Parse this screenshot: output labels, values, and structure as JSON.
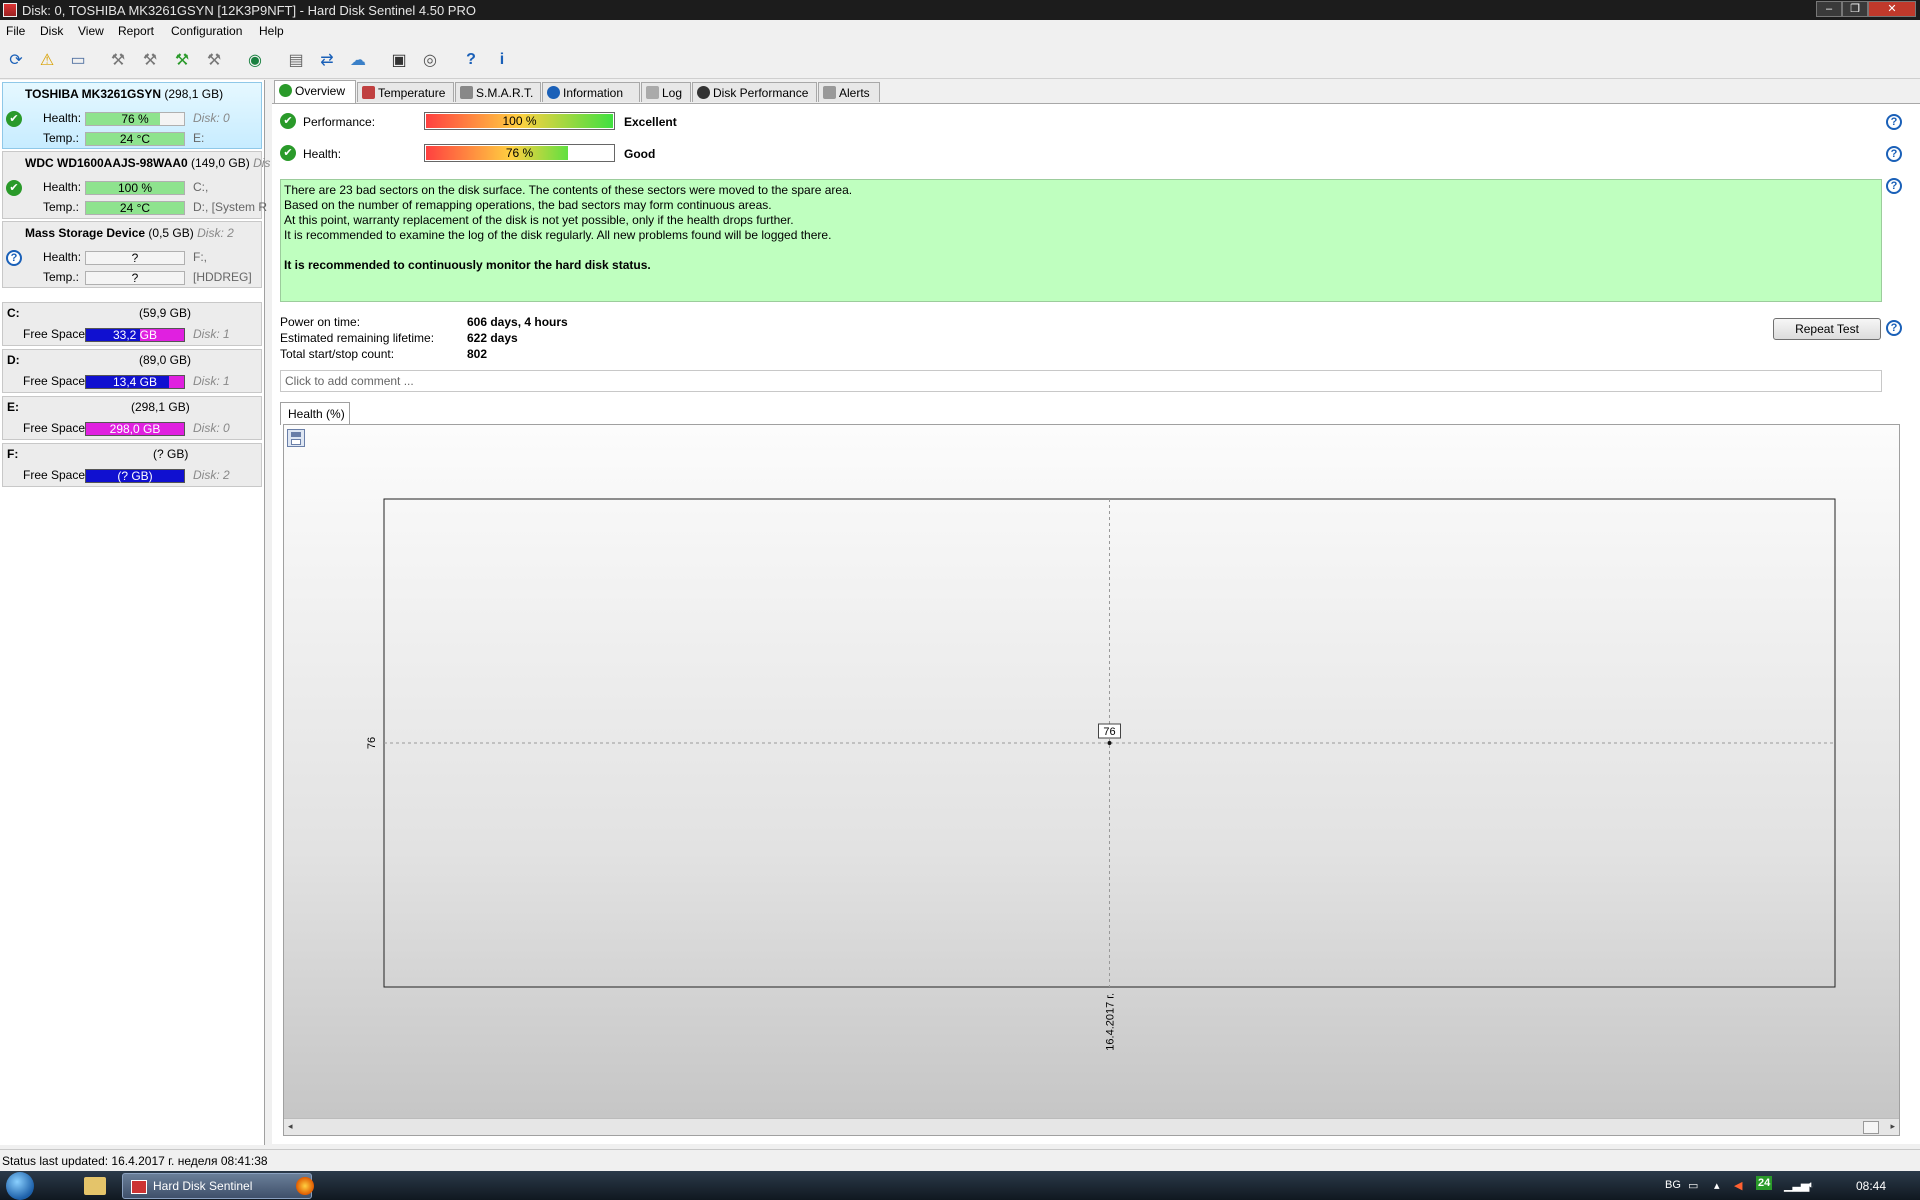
{
  "window": {
    "title": "Disk: 0, TOSHIBA MK3261GSYN [12K3P9NFT]  -  Hard Disk Sentinel 4.50 PRO"
  },
  "menu": [
    "File",
    "Disk",
    "View",
    "Report",
    "Configuration",
    "Help"
  ],
  "disks": [
    {
      "name": "TOSHIBA MK3261GSYN",
      "size": "(298,1 GB)",
      "health_label": "Health:",
      "health": "76 %",
      "health_fraction": 0.76,
      "disk_id": "Disk: 0",
      "temp_label": "Temp.:",
      "temp": "24 °C",
      "drives": "E:",
      "status": "ok"
    },
    {
      "name": "WDC WD1600AAJS-98WAA0",
      "size": "(149,0 GB)",
      "size_suffix": "Dis",
      "health_label": "Health:",
      "health": "100 %",
      "health_fraction": 1.0,
      "disk_id": "C:,",
      "temp_label": "Temp.:",
      "temp": "24 °C",
      "drives": "D:,  [System R",
      "status": "ok"
    },
    {
      "name": "Mass   Storage Device",
      "size": "(0,5 GB)",
      "size_suffix": "Disk: 2",
      "health_label": "Health:",
      "health": "?",
      "health_fraction": 0,
      "disk_id": "F:,",
      "temp_label": "Temp.:",
      "temp": "?",
      "drives": "[HDDREG]",
      "status": "unknown"
    }
  ],
  "volumes": [
    {
      "letter": "C:",
      "size": "(59,9 GB)",
      "free_label": "Free Space",
      "free": "33,2 GB",
      "free_fraction": 0.55,
      "disk": "Disk: 1"
    },
    {
      "letter": "D:",
      "size": "(89,0 GB)",
      "free_label": "Free Space",
      "free": "13,4 GB",
      "free_fraction": 0.85,
      "disk": "Disk: 1"
    },
    {
      "letter": "E:",
      "size": "(298,1 GB)",
      "free_label": "Free Space",
      "free": "298,0 GB",
      "free_fraction": 0.0,
      "disk": "Disk: 0"
    },
    {
      "letter": "F:",
      "size": "(? GB)",
      "free_label": "Free Space",
      "free": "(? GB)",
      "free_fraction": 1.0,
      "disk": "Disk: 2"
    }
  ],
  "tabs": [
    "Overview",
    "Temperature",
    "S.M.A.R.T.",
    "Information",
    "Log",
    "Disk Performance",
    "Alerts"
  ],
  "overview": {
    "performance_label": "Performance:",
    "performance_value": "100 %",
    "performance_fraction": 1.0,
    "performance_rating": "Excellent",
    "health_label": "Health:",
    "health_value": "76 %",
    "health_fraction": 0.76,
    "health_rating": "Good",
    "message_lines": [
      "There are 23 bad sectors on the disk surface. The contents of these sectors were moved to the spare area.",
      "Based on the number of remapping operations, the bad sectors may form continuous areas.",
      "At this point, warranty replacement of the disk is not yet possible, only if the health drops further.",
      "It is recommended to examine the log of the disk regularly. All new problems found will be logged there."
    ],
    "message_bold": "It is recommended to continuously monitor the hard disk status.",
    "power_on_label": "Power on time:",
    "power_on_value": "606 days, 4 hours",
    "remaining_label": "Estimated remaining lifetime:",
    "remaining_value": "622 days",
    "startstop_label": "Total start/stop count:",
    "startstop_value": "802",
    "repeat_test_label": "Repeat Test",
    "comment_placeholder": "Click to add comment ..."
  },
  "chart_tab_label": "Health (%)",
  "chart_data": {
    "type": "line",
    "x": [
      "16.4.2017 г."
    ],
    "series": [
      {
        "values": [
          76
        ]
      }
    ],
    "y_tick_labels": [
      "76"
    ],
    "data_labels": [
      "76"
    ],
    "grid": true
  },
  "statusbar": {
    "text": "Status last updated: 16.4.2017 г. неделя 08:41:38"
  },
  "taskbar": {
    "task_label": "Hard Disk Sentinel",
    "lang": "BG",
    "tray_badge": "24",
    "clock": "08:44"
  },
  "colors": {
    "ok": "#2a9a2a",
    "help": "#1a60b8",
    "message_bg": "#bfffbf",
    "free_used": "#1010d0",
    "free_free": "#e020e0",
    "health_bar": "#8ee38e"
  }
}
